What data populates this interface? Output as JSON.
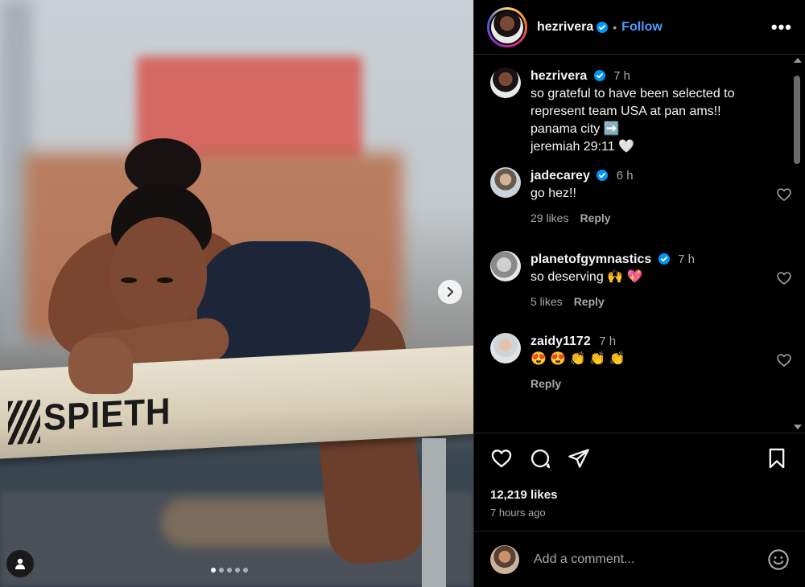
{
  "post": {
    "username": "hezrivera",
    "follow_label": "Follow",
    "separator": "•",
    "more_label": "•••",
    "carousel_dots": 5,
    "carousel_active_index": 0,
    "photo_brand_text": "SPIETH",
    "caption": {
      "username": "hezrivera",
      "time": "7 h",
      "lines": [
        "so grateful to have been selected to",
        "represent team USA at pan ams!!",
        "panama city ➡️",
        "jeremiah 29:11 🤍"
      ]
    },
    "comments": [
      {
        "username": "jadecarey",
        "verified": true,
        "time": "6 h",
        "text": "go hez!!",
        "likes": "29 likes",
        "reply": "Reply"
      },
      {
        "username": "planetofgymnastics",
        "verified": true,
        "time": "7 h",
        "text": "so deserving 🙌 💖",
        "likes": "5 likes",
        "reply": "Reply"
      },
      {
        "username": "zaidy1172",
        "verified": false,
        "time": "7 h",
        "text": "😍 😍 👏 👏 👏",
        "likes": "",
        "reply": "Reply"
      }
    ],
    "like_count": "12,219 likes",
    "posted_ago": "7 hours ago",
    "add_comment_placeholder": "Add a comment..."
  },
  "colors": {
    "accent_blue": "#4c9aff",
    "verified_blue": "#0095f6",
    "background": "#000000",
    "muted_text": "#a8a8a8"
  },
  "icons": [
    "chevron-right-icon",
    "user-tag-icon",
    "verified-icon",
    "more-icon",
    "heart-icon",
    "comment-icon",
    "share-icon",
    "bookmark-icon",
    "emoji-icon"
  ]
}
